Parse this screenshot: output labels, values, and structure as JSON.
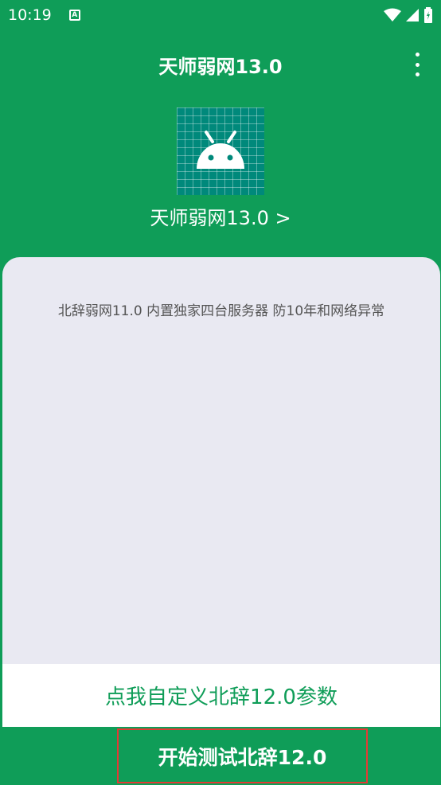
{
  "status_bar": {
    "time": "10:19",
    "notification_glyph": "A",
    "icons": [
      "wifi-icon",
      "signal-icon",
      "battery-icon"
    ]
  },
  "appbar": {
    "title": "天师弱网13.0",
    "menu_icon": "more-vert-icon"
  },
  "app_icon": "android-icon",
  "app_name": "天师弱网13.0 >",
  "card": {
    "description": "北辞弱网11.0 内置独家四台服务器 防10年和网络异常"
  },
  "custom_params_label": "点我自定义北辞12.0参数",
  "start_button_label": "开始测试北辞12.0",
  "colors": {
    "primary": "#0f9d58",
    "card_bg": "#e9e9f2",
    "highlight_border": "#e53935"
  }
}
